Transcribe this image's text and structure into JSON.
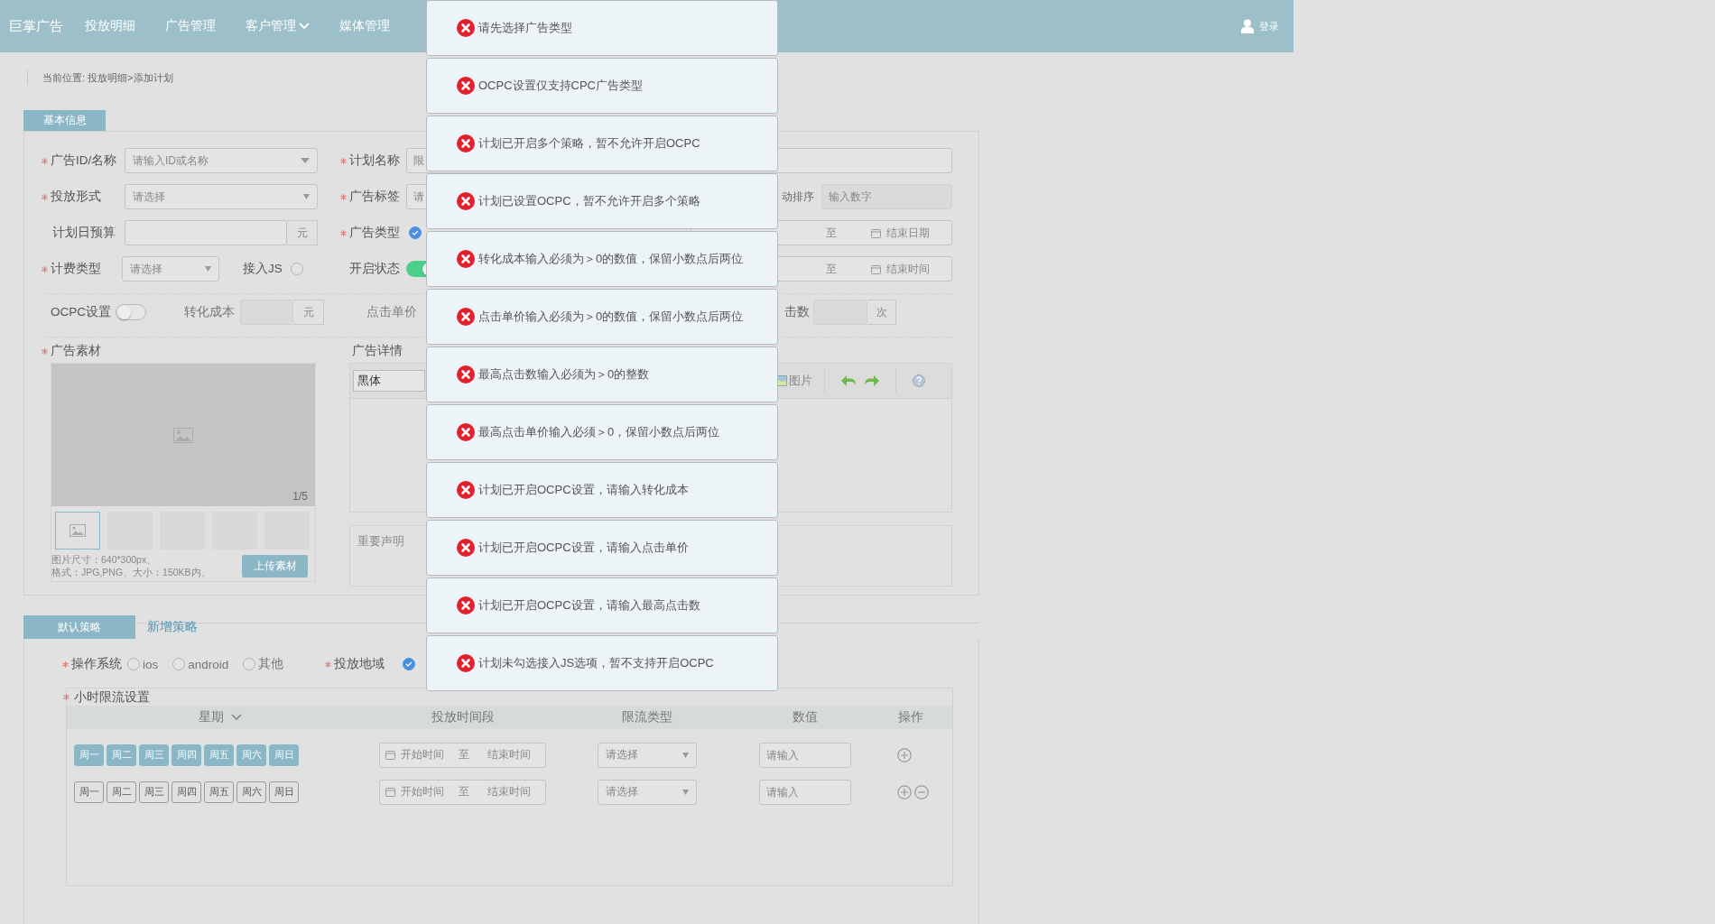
{
  "header": {
    "logo": "巨掌广告",
    "nav": [
      {
        "label": "投放明细",
        "dropdown": false
      },
      {
        "label": "广告管理",
        "dropdown": false
      },
      {
        "label": "客户管理",
        "dropdown": true
      },
      {
        "label": "媒体管理",
        "dropdown": false
      }
    ],
    "login": "登录"
  },
  "breadcrumb": "当前位置: 投放明细>添加计划",
  "basic_info": {
    "tab": "基本信息",
    "ad_id": {
      "label": "广告ID/名称",
      "required": true,
      "placeholder": "请输入ID或名称"
    },
    "plan_name": {
      "label": "计划名称",
      "required": true,
      "placeholder": "限"
    },
    "delivery_form": {
      "label": "投放形式",
      "required": true,
      "placeholder": "请选择"
    },
    "ad_tag": {
      "label": "广告标签",
      "required": true,
      "placeholder": "请"
    },
    "sort": {
      "label": "动排序",
      "placeholder": "输入数字"
    },
    "daily_budget": {
      "label": "计划日预算",
      "required": false,
      "unit": "元"
    },
    "ad_type": {
      "label": "广告类型",
      "required": true,
      "checked": true
    },
    "date_range": {
      "separator": "至",
      "end": "结束日期"
    },
    "billing_type": {
      "label": "计费类型",
      "required": true,
      "placeholder": "请选择"
    },
    "js": {
      "label": "接入JS",
      "checked": false
    },
    "status": {
      "label": "开启状态",
      "required": false,
      "on": true
    },
    "time_range": {
      "separator": "至",
      "end": "结束时间"
    },
    "ocpc": {
      "label": "OCPC设置",
      "on": false
    },
    "conversion_cost": {
      "label": "转化成本",
      "unit": "元"
    },
    "click_price": {
      "label": "点击单价"
    },
    "max_clicks": {
      "label": "击数",
      "unit": "次"
    },
    "material": {
      "label": "广告素材",
      "required": true,
      "counter": "1/5",
      "thumbs": [
        {
          "selected": true
        },
        {
          "selected": false
        },
        {
          "selected": false
        },
        {
          "selected": false
        },
        {
          "selected": false
        }
      ],
      "hint_lines": [
        "图片尺寸：640*300px、",
        "格式：JPG,PNG、大小：150KB内、"
      ],
      "upload": "上传素材"
    },
    "detail": {
      "label": "广告详情",
      "font": "黑体",
      "image_button": "图片",
      "statement_placeholder": "重要声明"
    }
  },
  "strategy": {
    "tabs": [
      {
        "label": "默认策略",
        "selected": true
      },
      {
        "label": "新增策略",
        "selected": false
      }
    ],
    "os": {
      "label": "操作系统",
      "required": true,
      "options": [
        {
          "label": "ios",
          "selected": false
        },
        {
          "label": "android",
          "selected": false
        },
        {
          "label": "其他",
          "selected": false
        }
      ]
    },
    "region": {
      "label": "投放地域",
      "required": true,
      "checked": true
    },
    "hourly": {
      "label": "小时限流设置",
      "required": true,
      "columns": [
        {
          "label": "星期",
          "dropdown": true
        },
        {
          "label": "投放时间段",
          "dropdown": false
        },
        {
          "label": "限流类型",
          "dropdown": false
        },
        {
          "label": "数值",
          "dropdown": false
        },
        {
          "label": "操作",
          "dropdown": false
        }
      ],
      "rows": [
        {
          "days": [
            {
              "label": "周一",
              "selected": true
            },
            {
              "label": "周二",
              "selected": true
            },
            {
              "label": "周三",
              "selected": true
            },
            {
              "label": "周四",
              "selected": true
            },
            {
              "label": "周五",
              "selected": true
            },
            {
              "label": "周六",
              "selected": true
            },
            {
              "label": "周日",
              "selected": true
            }
          ],
          "start": "开始时间",
          "separator": "至",
          "end": "结束时间",
          "type_placeholder": "请选择",
          "value_placeholder": "请输入",
          "removable": false
        },
        {
          "days": [
            {
              "label": "周一",
              "selected": false
            },
            {
              "label": "周二",
              "selected": false
            },
            {
              "label": "周三",
              "selected": false
            },
            {
              "label": "周四",
              "selected": false
            },
            {
              "label": "周五",
              "selected": false
            },
            {
              "label": "周六",
              "selected": false
            },
            {
              "label": "周日",
              "selected": false
            }
          ],
          "start": "开始时间",
          "separator": "至",
          "end": "结束时间",
          "type_placeholder": "请选择",
          "value_placeholder": "请输入",
          "removable": true
        }
      ]
    }
  },
  "toasts": [
    {
      "message": "请先选择广告类型"
    },
    {
      "message": "OCPC设置仅支持CPC广告类型"
    },
    {
      "message": "计划已开启多个策略，暂不允许开启OCPC"
    },
    {
      "message": "计划已设置OCPC，暂不允许开启多个策略"
    },
    {
      "message": "转化成本输入必须为＞0的数值，保留小数点后两位"
    },
    {
      "message": "点击单价输入必须为＞0的数值，保留小数点后两位"
    },
    {
      "message": "最高点击数输入必须为＞0的整数"
    },
    {
      "message": "最高点击单价输入必须＞0，保留小数点后两位"
    },
    {
      "message": "计划已开启OCPC设置，请输入转化成本"
    },
    {
      "message": "计划已开启OCPC设置，请输入点击单价"
    },
    {
      "message": "计划已开启OCPC设置，请输入最高点击数"
    },
    {
      "message": "计划未勾选接入JS选项，暂不支持开启OCPC"
    }
  ]
}
